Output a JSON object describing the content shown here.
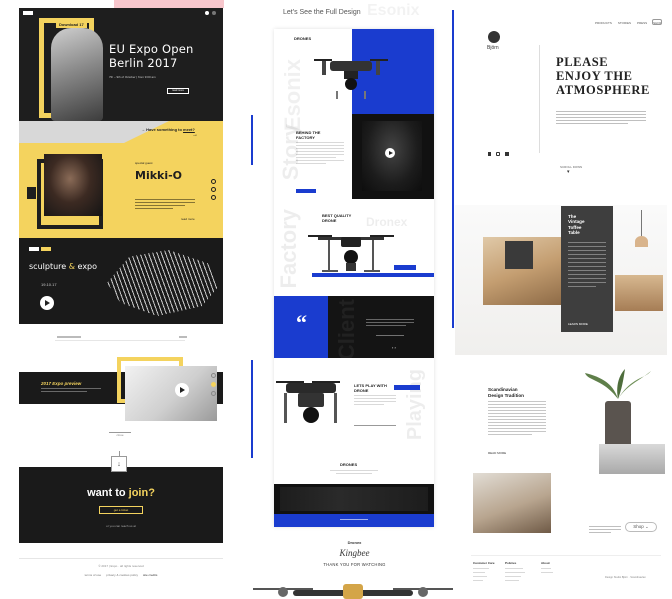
{
  "left": {
    "hero": {
      "badge": "Download 17",
      "title_line1": "EU Expo Open",
      "title_line2": "Berlin 2017",
      "date": "7th – 9th of October | from 9:00 am",
      "cta": "read more",
      "prompt": "→ Have something to",
      "prompt_link": "meet?",
      "arrow": "→"
    },
    "artist": {
      "kicker": "special guest",
      "name": "Mikki-O",
      "more": "read more"
    },
    "sculpture": {
      "title_a": "sculpture",
      "title_amp": "&",
      "title_b": "expo",
      "date": "19.10.17"
    },
    "preview": {
      "title": "2017 Expo preview",
      "close": "close"
    },
    "join": {
      "title_a": "want to",
      "title_b": "join?",
      "button": "get a ticket",
      "note": "or you can reach us at"
    },
    "footer": {
      "line1": "© 2017 | Expo · all rights reserved",
      "links": [
        "terms of use",
        "privacy & cookies policy",
        "site credits"
      ]
    },
    "colors": {
      "yellow": "#f4d35e",
      "dark": "#1e1e1e"
    }
  },
  "middle": {
    "heading": "Let's See the Full Design",
    "watermark_top": "Esonix",
    "watermark_story": "Story",
    "watermark_factory": "Factory",
    "watermark_dronex": "Dronex",
    "watermark_client": "Client",
    "watermark_playing": "Playing",
    "s1_label": "DRONES",
    "s2_label_1": "BEHIND THE",
    "s2_label_2": "FACTORY",
    "s3_label_1": "BEST QUALITY",
    "s3_label_2": "DRONE",
    "quote_mark": "“",
    "s5_label_1": "LETS PLAY WITH",
    "s5_label_2": "DRONE",
    "s6_label": "DRONES",
    "thanks_brand": "Dronex",
    "thanks_sign": "Kingbee",
    "thanks_text": "THANK YOU FOR WATCHING",
    "colors": {
      "blue": "#1a3ccf"
    }
  },
  "right": {
    "brand": "Björn",
    "nav": [
      "PRODUCTS",
      "STORIES",
      "PRESS",
      "SHOP"
    ],
    "headline_1": "PLEASE",
    "headline_2": "ENJOY THE",
    "headline_3": "ATMOSPHERE",
    "scroll": "SCROLL DOWN",
    "card_title_1": "The",
    "card_title_2": "Vintage",
    "card_title_3": "Toffee",
    "card_title_4": "Table",
    "card_more": "LEARN MORE",
    "scandi_1": "Scandinavian",
    "scandi_2": "Design Tradition",
    "scandi_more": "READ MORE",
    "shop": "Shop",
    "footer_cols": [
      "Customer Care",
      "Policies",
      "About"
    ],
    "copyright": "Design Studio Björn · Scandinavian"
  }
}
